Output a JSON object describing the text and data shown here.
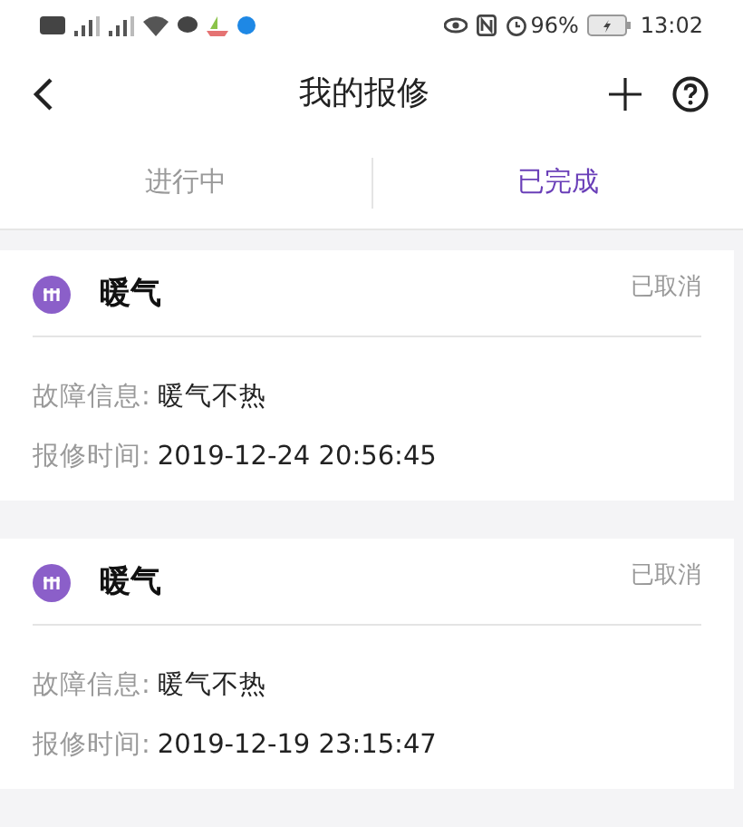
{
  "status_bar": {
    "battery": "96%",
    "time": "13:02"
  },
  "header": {
    "title": "我的报修"
  },
  "tabs": [
    {
      "label": "进行中",
      "selected": false
    },
    {
      "label": "已完成",
      "selected": true
    }
  ],
  "orders": [
    {
      "title": "暖气",
      "status": "已取消",
      "fault_label": "故障信息:",
      "fault": "暖气不热",
      "time_label": "报修时间:",
      "time": "2019-12-24 20:56:45"
    },
    {
      "title": "暖气",
      "status": "已取消",
      "fault_label": "故障信息:",
      "fault": "暖气不热",
      "time_label": "报修时间:",
      "time": "2019-12-19 23:15:47"
    }
  ]
}
